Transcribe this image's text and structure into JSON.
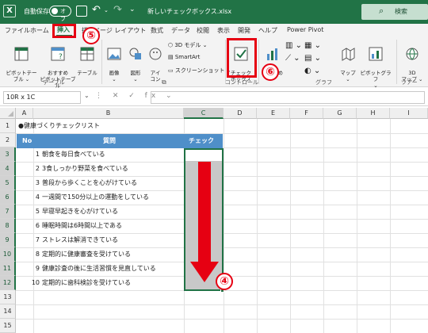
{
  "titlebar": {
    "logo": "X",
    "autosave_label": "自動保存",
    "autosave_state": "オフ",
    "more": "⌄",
    "filename": "新しいチェックボックス.xlsx",
    "search_label": "検索"
  },
  "tabs": [
    "ファイル",
    "ホーム",
    "挿入",
    "描",
    "ページ レイアウト",
    "数式",
    "データ",
    "校閲",
    "表示",
    "開発",
    "ヘルプ",
    "Power Pivot"
  ],
  "ribbon": {
    "pivot_table": "ピボットテー\nブル ⌄",
    "recommended_pivot": "おすすめ\nピボットテーブル",
    "table": "テーブル",
    "picture": "画像\n⌄",
    "shapes": "図形\n⌄",
    "icons": "アイ\nコン",
    "model3d": "3D モデル ⌄",
    "smartart": "SmartArt",
    "screenshot": "スクリーンショット ⌄",
    "checkbox": "チェック\nボックス",
    "recommended_charts": "おすすめ",
    "map": "マップ\n⌄",
    "pivot_chart": "ピボットグラフ\n⌄",
    "map3d": "3D\nマップ ⌄",
    "group_table": "テーブル",
    "group_control": "コントロール",
    "group_chart": "グラフ",
    "group_tour": "ツアー"
  },
  "formula_bar": {
    "name_box": "10R x 1C",
    "fx_icons": "⋮ ✕ ✓ fx ⌄",
    "formula": ""
  },
  "sheet": {
    "columns": [
      "A",
      "B",
      "C",
      "D",
      "E",
      "F",
      "G",
      "H",
      "I"
    ],
    "rows": [
      "1",
      "2",
      "3",
      "4",
      "5",
      "6",
      "7",
      "8",
      "9",
      "10",
      "11",
      "12",
      "13",
      "14",
      "15"
    ],
    "title": "●健康づくりチェックリスト",
    "header_no": "No",
    "header_question": "質問",
    "header_check": "チェック",
    "items": [
      {
        "no": "1",
        "q": "朝食を毎日食べている"
      },
      {
        "no": "2",
        "q": "3食しっかり野菜を食べている"
      },
      {
        "no": "3",
        "q": "普段から歩くことを心がけている"
      },
      {
        "no": "4",
        "q": "一週間で150分以上の運動をしている"
      },
      {
        "no": "5",
        "q": "早寝早起きを心がけている"
      },
      {
        "no": "6",
        "q": "睡眠時間は6時間以上である"
      },
      {
        "no": "7",
        "q": "ストレスは解消できている"
      },
      {
        "no": "8",
        "q": "定期的に健康審査を受けている"
      },
      {
        "no": "9",
        "q": "健康診査の後に生活習慣を見直している"
      },
      {
        "no": "10",
        "q": "定期的に歯科検診を受けている"
      }
    ]
  },
  "annotations": {
    "step4": "④",
    "step5": "⑤",
    "step6": "⑥",
    "color": "#e60012"
  },
  "colors": {
    "excel_green": "#217346",
    "header_blue": "#4f8fc9"
  }
}
